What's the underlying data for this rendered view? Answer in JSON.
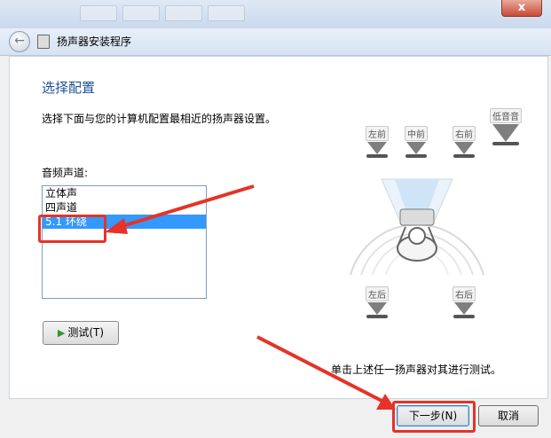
{
  "window": {
    "title": "扬声器安装程序",
    "close_label": "x"
  },
  "page": {
    "heading": "选择配置",
    "description": "选择下面与您的计算机配置最相近的扬声器设置。",
    "channels_label": "音频声道:",
    "channels": [
      {
        "label": "立体声",
        "selected": false
      },
      {
        "label": "四声道",
        "selected": false
      },
      {
        "label": "5.1 环绕",
        "selected": true
      }
    ],
    "test_button": "测试(T)",
    "hint": "单击上述任一扬声器对其进行测试。"
  },
  "speakers": {
    "front_left": "左前",
    "center": "中前",
    "front_right": "右前",
    "subwoofer": "低音音",
    "rear_left": "左后",
    "rear_right": "右后"
  },
  "footer": {
    "next_label": "下一步(N)",
    "cancel_label": "取消"
  },
  "colors": {
    "annotation_red": "#e53328",
    "heading_blue": "#1e4e9b",
    "selection_blue": "#3399ff"
  }
}
